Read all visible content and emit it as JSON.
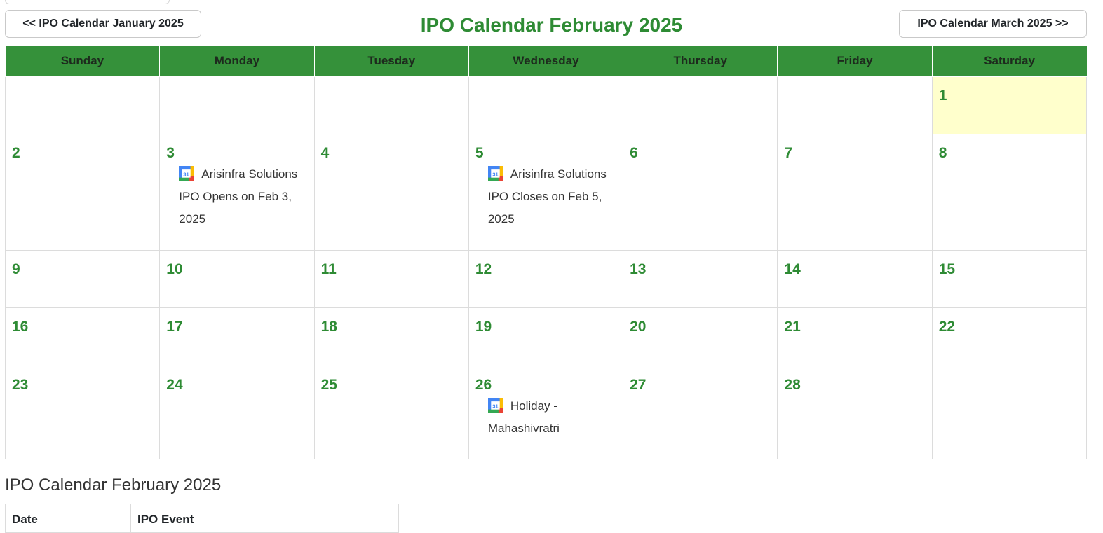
{
  "navigation": {
    "prev_label": "<< IPO Calendar January 2025",
    "next_label": "IPO Calendar March 2025 >>"
  },
  "calendar": {
    "title": "IPO Calendar February 2025",
    "weekdays": [
      "Sunday",
      "Monday",
      "Tuesday",
      "Wednesday",
      "Thursday",
      "Friday",
      "Saturday"
    ],
    "today": "1",
    "weeks": [
      [
        null,
        null,
        null,
        null,
        null,
        null,
        {
          "day": "1"
        }
      ],
      [
        {
          "day": "2"
        },
        {
          "day": "3",
          "events": [
            "Arisinfra Solutions IPO Opens on Feb 3, 2025"
          ]
        },
        {
          "day": "4"
        },
        {
          "day": "5",
          "events": [
            "Arisinfra Solutions IPO Closes on Feb 5, 2025"
          ]
        },
        {
          "day": "6"
        },
        {
          "day": "7"
        },
        {
          "day": "8"
        }
      ],
      [
        {
          "day": "9"
        },
        {
          "day": "10"
        },
        {
          "day": "11"
        },
        {
          "day": "12"
        },
        {
          "day": "13"
        },
        {
          "day": "14"
        },
        {
          "day": "15"
        }
      ],
      [
        {
          "day": "16"
        },
        {
          "day": "17"
        },
        {
          "day": "18"
        },
        {
          "day": "19"
        },
        {
          "day": "20"
        },
        {
          "day": "21"
        },
        {
          "day": "22"
        }
      ],
      [
        {
          "day": "23"
        },
        {
          "day": "24"
        },
        {
          "day": "25"
        },
        {
          "day": "26",
          "events": [
            "Holiday - Mahashivratri"
          ]
        },
        {
          "day": "27"
        },
        {
          "day": "28"
        },
        null
      ]
    ],
    "event_icon": "google-calendar-icon",
    "icon_day": "31"
  },
  "event_list": {
    "title": "IPO Calendar February 2025",
    "columns": [
      "Date",
      "IPO Event"
    ]
  },
  "colors": {
    "accent": "#2e8b34",
    "header_bg": "#35913a",
    "today_bg": "#ffffcc"
  }
}
